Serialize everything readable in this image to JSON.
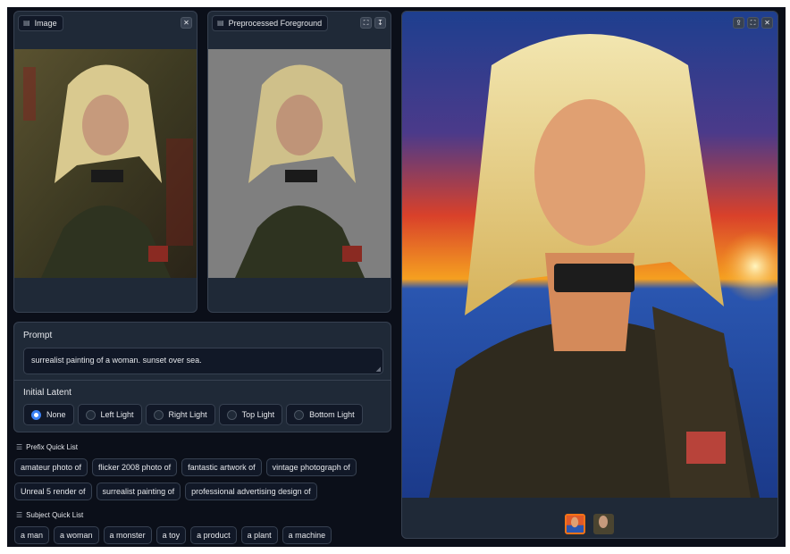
{
  "image_panel": {
    "label": "Image",
    "label_icon": "image-icon",
    "close_icon": "close-icon"
  },
  "foreground_panel": {
    "label": "Preprocessed Foreground",
    "label_icon": "image-icon",
    "fullscreen_icon": "fullscreen-icon",
    "download_icon": "download-icon"
  },
  "gallery": {
    "share_icon": "share-icon",
    "fullscreen_icon": "fullscreen-icon",
    "close_icon": "close-icon",
    "thumb_count": 2
  },
  "prompt": {
    "label": "Prompt",
    "value": "surrealist painting of a woman. sunset over sea."
  },
  "initial_latent": {
    "label": "Initial Latent",
    "options": [
      "None",
      "Left Light",
      "Right Light",
      "Top Light",
      "Bottom Light"
    ],
    "selected": "None"
  },
  "prefix_quick_list": {
    "label": "Prefix Quick List",
    "row1": [
      "amateur photo of",
      "flicker 2008 photo of",
      "fantastic artwork of",
      "vintage photograph of"
    ],
    "row2": [
      "Unreal 5 render of",
      "surrealist painting of",
      "professional advertising design of"
    ]
  },
  "subject_quick_list": {
    "label": "Subject Quick List",
    "items": [
      "a man",
      "a woman",
      "a monster",
      "a toy",
      "a product",
      "a plant",
      "a machine"
    ]
  },
  "colors": {
    "background": "#0b0f19",
    "panel": "#1f2937",
    "border": "#374151",
    "accent": "#3b82f6"
  }
}
